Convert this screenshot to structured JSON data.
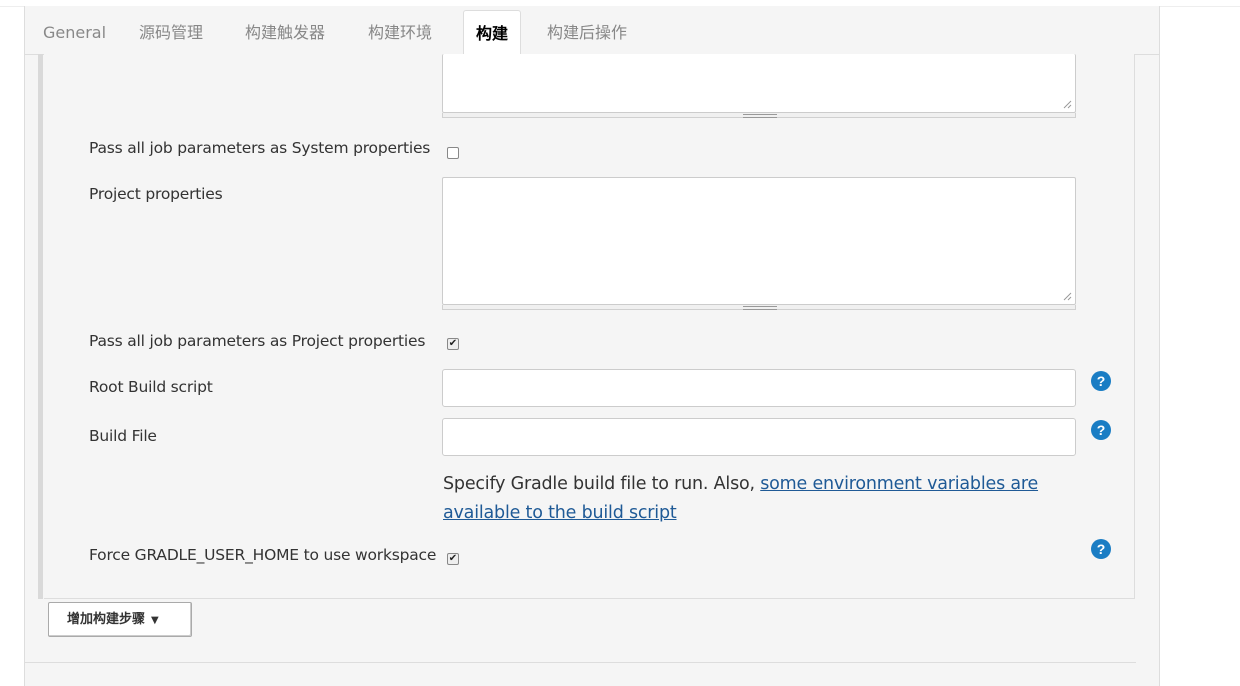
{
  "tabs": [
    {
      "label": "General",
      "active": false
    },
    {
      "label": "源码管理",
      "active": false
    },
    {
      "label": "构建触发器",
      "active": false
    },
    {
      "label": "构建环境",
      "active": false
    },
    {
      "label": "构建",
      "active": true
    },
    {
      "label": "构建后操作",
      "active": false
    }
  ],
  "form": {
    "pass_system_props_label": "Pass all job parameters as System properties",
    "pass_system_props_checked": false,
    "project_properties_label": "Project properties",
    "project_properties_value": "",
    "pass_project_props_label": "Pass all job parameters as Project properties",
    "pass_project_props_checked": true,
    "root_build_script_label": "Root Build script",
    "root_build_script_value": "",
    "build_file_label": "Build File",
    "build_file_value": "",
    "build_file_desc_prefix": "Specify Gradle build file to run. Also, ",
    "build_file_desc_link": "some environment variables are available to the build script",
    "force_gradle_home_label": "Force GRADLE_USER_HOME to use workspace",
    "force_gradle_home_checked": true
  },
  "icons": {
    "help": "?",
    "caret": "▼",
    "check": "✔"
  },
  "add_step_button": "增加构建步骤",
  "colors": {
    "panel_bg": "#f5f5f5",
    "help_blue": "#1a7dc4",
    "link": "#1f5a96"
  }
}
